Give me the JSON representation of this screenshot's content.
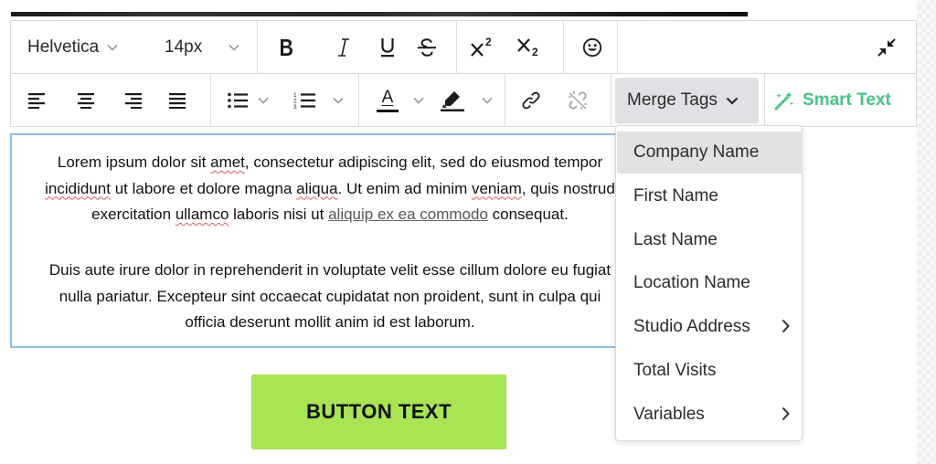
{
  "toolbar": {
    "font_family": "Helvetica",
    "font_size": "14px",
    "merge_tags_label": "Merge Tags",
    "smart_text_label": "Smart Text",
    "underline_glyph": "U",
    "text_color_glyph": "A"
  },
  "editor": {
    "paragraph1": {
      "l1_a": "Lorem ipsum dolor sit ",
      "l1_b": "amet",
      "l1_c": ", consectetur adipiscing elit, sed do eiusmod tempor",
      "l2_a": "incididunt",
      "l2_b": " ut labore et dolore magna ",
      "l2_c": "aliqua",
      "l2_d": ". Ut enim ad minim ",
      "l2_e": "veniam",
      "l2_f": ", quis nostrud",
      "l3_a": "exercitation ",
      "l3_b": "ullamco",
      "l3_c": " laboris nisi ut ",
      "l3_link": "aliquip ex ea commodo",
      "l3_d": " consequat."
    },
    "paragraph2": {
      "l1": "Duis aute irure dolor in reprehenderit in voluptate velit esse cillum dolore eu fugiat",
      "l2": "nulla pariatur. Excepteur sint occaecat cupidatat non proident, sunt in culpa qui",
      "l3": "officia deserunt mollit anim id est laborum."
    }
  },
  "button": {
    "label": "BUTTON TEXT"
  },
  "merge_tags_menu": {
    "items": [
      {
        "label": "Company Name",
        "has_submenu": false,
        "active": true
      },
      {
        "label": "First Name",
        "has_submenu": false,
        "active": false
      },
      {
        "label": "Last Name",
        "has_submenu": false,
        "active": false
      },
      {
        "label": "Location Name",
        "has_submenu": false,
        "active": false
      },
      {
        "label": "Studio Address",
        "has_submenu": true,
        "active": false
      },
      {
        "label": "Total Visits",
        "has_submenu": false,
        "active": false
      },
      {
        "label": "Variables",
        "has_submenu": true,
        "active": false
      }
    ]
  },
  "colors": {
    "smart_text": "#48c286",
    "button_bg": "#a8e453",
    "editor_border": "#8dbde6",
    "merge_button_bg": "#dfe1e4",
    "menu_active_bg": "#e2e2e4"
  },
  "icons": [
    "chevron-down-icon",
    "bold-icon",
    "italic-icon",
    "underline-icon",
    "strikethrough-icon",
    "superscript-icon",
    "subscript-icon",
    "emoji-icon",
    "collapse-icon",
    "align-left-icon",
    "align-center-icon",
    "align-right-icon",
    "align-justify-icon",
    "bullet-list-icon",
    "numbered-list-icon",
    "text-color-icon",
    "highlight-icon",
    "link-icon",
    "unlink-icon",
    "magic-wand-icon",
    "chevron-right-icon"
  ]
}
